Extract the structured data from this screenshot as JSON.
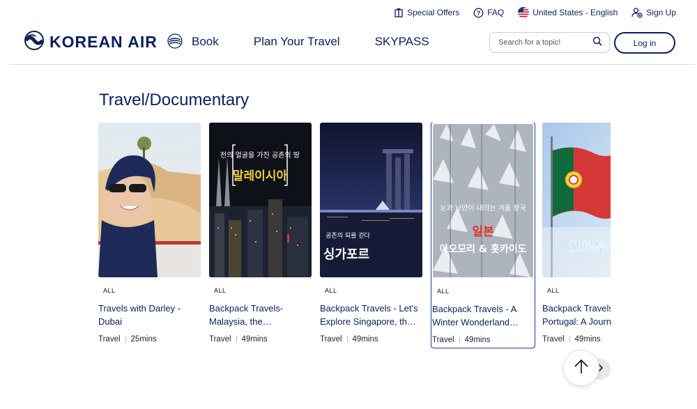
{
  "utility": {
    "special_offers": "Special Offers",
    "faq": "FAQ",
    "region": "United States - English",
    "sign_up": "Sign Up"
  },
  "brand": {
    "name": "KOREAN AIR"
  },
  "nav": {
    "book": "Book",
    "plan": "Plan Your Travel",
    "skypass": "SKYPASS"
  },
  "search": {
    "placeholder": "Search for a topic!"
  },
  "login": "Log in",
  "section": {
    "title": "Travel/Documentary"
  },
  "cards": [
    {
      "tag": "ALL",
      "title": "Travels with Darley - Dubai",
      "category": "Travel",
      "duration": "25mins"
    },
    {
      "tag": "ALL",
      "title": "Backpack Travels-Malaysia, the…",
      "category": "Travel",
      "duration": "49mins",
      "overlay": [
        "천의 얼굴을 가진 공존의 땅",
        "말레이시아"
      ]
    },
    {
      "tag": "ALL",
      "title": "Backpack Travels - Let's Explore Singapore, th…",
      "category": "Travel",
      "duration": "49mins",
      "overlay": [
        "공존의 되를 걷다",
        "싱가포르"
      ]
    },
    {
      "tag": "ALL",
      "title": "Backpack Travels - A Winter Wonderland…",
      "category": "Travel",
      "duration": "49mins",
      "overlay": [
        "눈과 낭만이 내리는 겨울 왕국",
        "일본",
        "아오모리 & 홋카이도"
      ]
    },
    {
      "tag": "ALL",
      "title": "Backpack Travels - Portugal: A Journ…",
      "category": "Travel",
      "duration": "49mins",
      "overlay": [
        "포르투갈"
      ]
    }
  ],
  "colors": {
    "brand": "#0a1f5c",
    "accent_red": "#e0332b"
  }
}
